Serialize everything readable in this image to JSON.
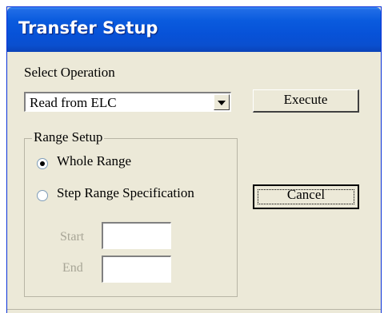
{
  "window": {
    "title": "Transfer Setup"
  },
  "operation": {
    "label": "Select Operation",
    "selected": "Read from ELC"
  },
  "buttons": {
    "execute": "Execute",
    "cancel": "Cancel"
  },
  "range": {
    "legend": "Range Setup",
    "options": [
      {
        "label": "Whole Range",
        "checked": true
      },
      {
        "label": "Step Range Specification",
        "checked": false
      }
    ],
    "start_label": "Start",
    "end_label": "End",
    "start_value": "",
    "end_value": ""
  },
  "colors": {
    "titlebar": "#0752d8",
    "dialog_bg": "#ece9d8",
    "disabled_text": "#a7a596"
  }
}
